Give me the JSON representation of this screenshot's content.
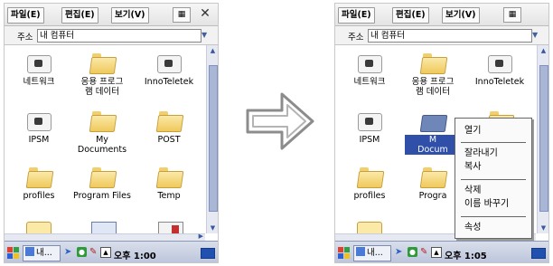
{
  "before": {
    "menu": {
      "file": "파일(E)",
      "edit": "편집(E)",
      "view": "보기(V)"
    },
    "address": {
      "label": "주소",
      "value": "내 컴퓨터"
    },
    "items": [
      {
        "label": "네트워크",
        "icon": "network-share-icon"
      },
      {
        "label": "응용 프로그\n램 데이터",
        "icon": "folder-icon"
      },
      {
        "label": "InnoTeletek",
        "icon": "network-share-icon"
      },
      {
        "label": "IPSM",
        "icon": "network-share-icon"
      },
      {
        "label": "My\nDocuments",
        "icon": "folder-icon"
      },
      {
        "label": "POST",
        "icon": "folder-icon"
      },
      {
        "label": "profiles",
        "icon": "folder-icon"
      },
      {
        "label": "Program Files",
        "icon": "folder-icon"
      },
      {
        "label": "Temp",
        "icon": "folder-icon"
      }
    ],
    "taskbar": {
      "task_label": "내...",
      "clock": "오후 1:00"
    }
  },
  "after": {
    "menu": {
      "file": "파일(E)",
      "edit": "편집(E)",
      "view": "보기(V)"
    },
    "address": {
      "label": "주소",
      "value": "내 컴퓨터"
    },
    "items": [
      {
        "label": "네트워크"
      },
      {
        "label": "응용 프로그\n램 데이터"
      },
      {
        "label": "InnoTeletek"
      },
      {
        "label": "IPSM"
      },
      {
        "label": "M\nDocum",
        "selected": true
      },
      {
        "label": "profiles"
      },
      {
        "label": "Progra"
      }
    ],
    "context_menu": [
      "열기",
      "잘라내기",
      "복사",
      "삭제",
      "이름 바꾸기",
      "속성"
    ],
    "taskbar": {
      "task_label": "내...",
      "clock": "오후 1:05"
    }
  },
  "colors": {
    "selection": "#2f4fa8",
    "folder": "#efc95c",
    "arrow": "#8c8c8c"
  }
}
